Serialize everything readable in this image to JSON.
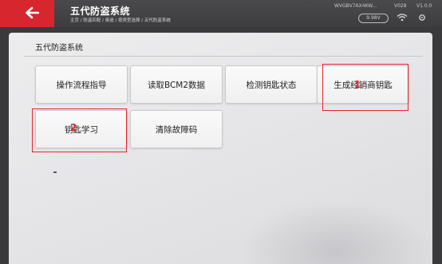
{
  "header": {
    "title": "五代防盗系统",
    "breadcrumb": "主页 / 防盗匹配 / 奥迪 / 按类型选择 / 五代防盗系统",
    "vin": "WVGBV7AX4KW...",
    "vehicle_code": "V028",
    "version": "V1.0.0",
    "battery": "9.98V"
  },
  "panel": {
    "section_title": "五代防盗系统",
    "buttons": [
      "操作流程指导",
      "读取BCM2数据",
      "检测钥匙状态",
      "生成经销商钥匙",
      "钥匙学习",
      "清除故障码"
    ]
  },
  "annotations": {
    "mark_1": "1",
    "mark_2": "2",
    "color": "#e3262c"
  },
  "icons": [
    "back-arrow-icon",
    "battery-icon",
    "wifi-icon",
    "settings-icon"
  ]
}
